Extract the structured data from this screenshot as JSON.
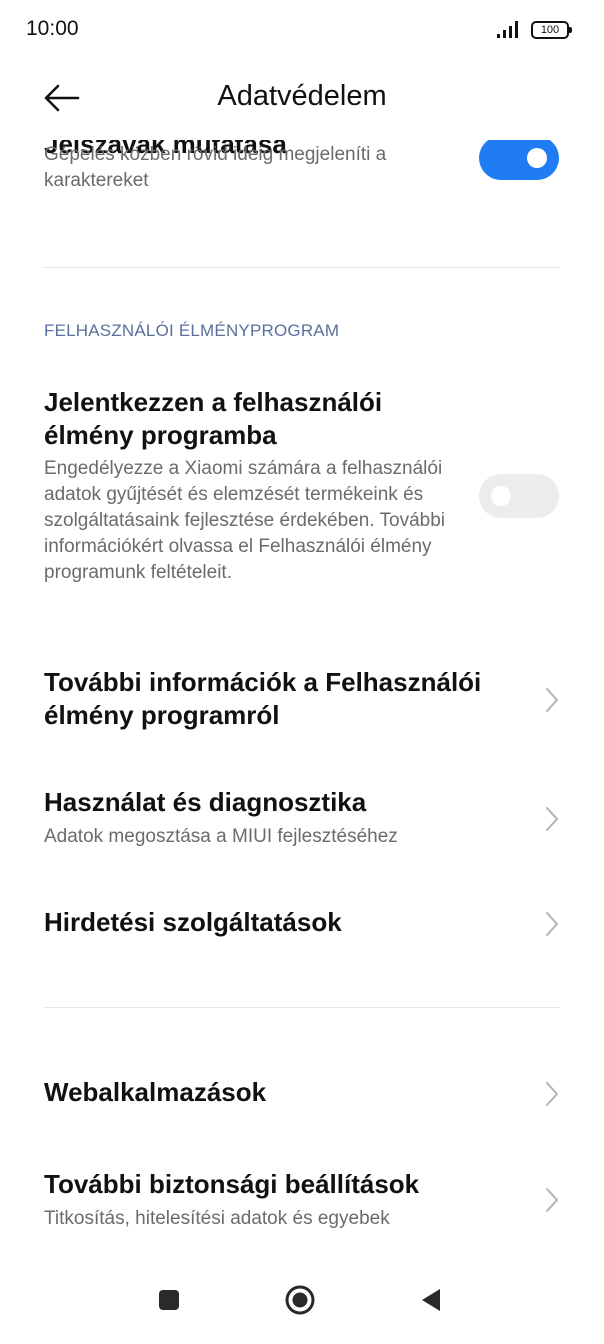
{
  "status_bar": {
    "time": "10:00",
    "battery": "100",
    "signal_icon": "cellular-signal-icon",
    "battery_icon": "battery-icon"
  },
  "header": {
    "title": "Adatvédelem",
    "back_icon": "arrow-left-icon"
  },
  "items": {
    "show_chars": {
      "title_partial": "Jelszavak mutatása",
      "subtitle": "Gépelés közben rövid ideig megjeleníti a karaktereket",
      "toggle_on": true
    },
    "section_ux": "FELHASZNÁLÓI ÉLMÉNYPROGRAM",
    "ux_program": {
      "title": "Jelentkezzen a felhasználói élmény programba",
      "subtitle": "Engedélyezze a Xiaomi számára a felhasználói adatok gyűjtését és elemzését termékeink és szolgáltatásaink fejlesztése érdekében. További információkért olvassa el Felhasználói élmény programunk feltételeit.",
      "toggle_on": false
    },
    "ux_info": {
      "title": "További információk a Felhasználói élmény programról"
    },
    "diagnostics": {
      "title": "Használat és diagnosztika",
      "subtitle": "Adatok megosztása a MIUI fejlesztéséhez"
    },
    "ads": {
      "title": "Hirdetési szolgáltatások"
    },
    "web_apps": {
      "title": "Webalkalmazások"
    },
    "security": {
      "title": "További biztonsági beállítások",
      "subtitle": "Titkosítás, hitelesítési adatok és egyebek"
    }
  },
  "colors": {
    "accent": "#1f7cf2",
    "section_header": "#5a6f9c",
    "toggle_off": "#ececec"
  },
  "nav_bar": {
    "recents_icon": "square-recents-icon",
    "home_icon": "circle-home-icon",
    "back_icon": "triangle-back-icon"
  }
}
